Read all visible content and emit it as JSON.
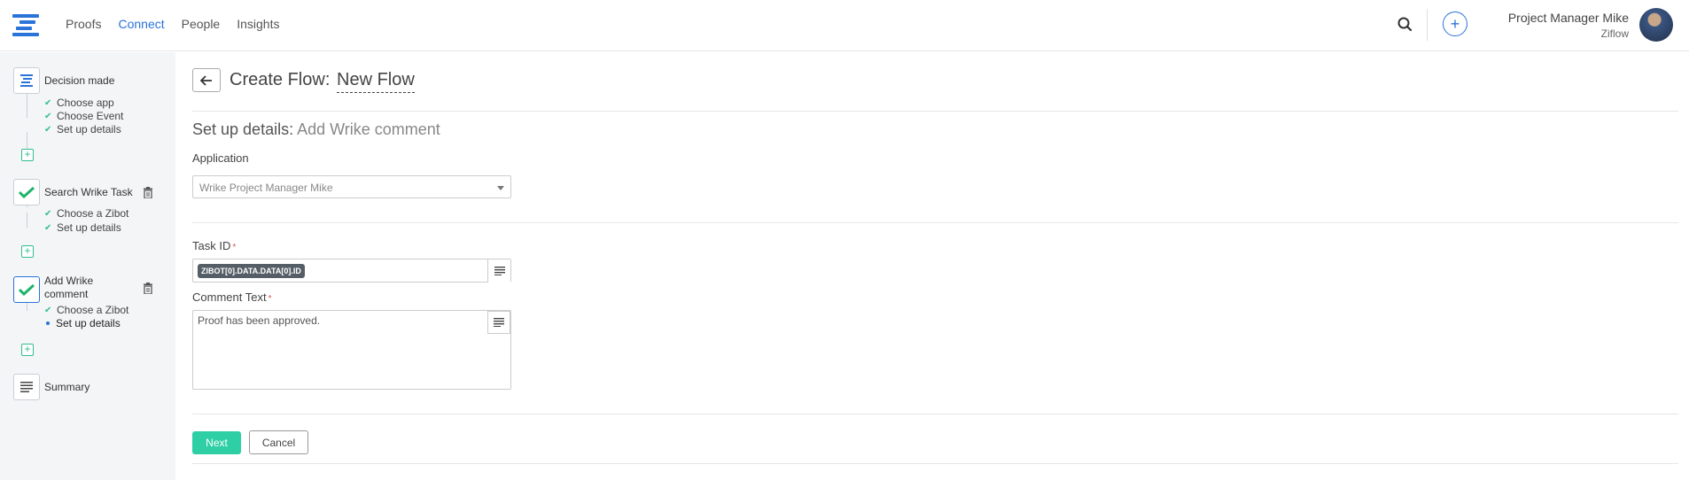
{
  "nav": {
    "items": [
      "Proofs",
      "Connect",
      "People",
      "Insights"
    ],
    "active": "Connect"
  },
  "user": {
    "name": "Project Manager Mike",
    "org": "Ziflow"
  },
  "sidebar": {
    "steps": [
      {
        "title": "Decision made",
        "subs": [
          "Choose app",
          "Choose Event",
          "Set up details"
        ]
      },
      {
        "title": "Search Wrike Task",
        "subs": [
          "Choose a Zibot",
          "Set up details"
        ]
      },
      {
        "title": "Add Wrike comment",
        "subs": [
          "Choose a Zibot",
          "Set up details"
        ]
      },
      {
        "title": "Summary",
        "subs": []
      }
    ]
  },
  "header": {
    "title_prefix": "Create Flow:",
    "flow_name": "New Flow"
  },
  "form": {
    "section_title": "Set up details:",
    "section_subtitle": "Add Wrike comment",
    "application_label": "Application",
    "application_value": "Wrike Project Manager Mike",
    "task_id_label": "Task ID",
    "task_id_token": "ZIBOT[0].DATA.DATA[0].ID",
    "comment_label": "Comment Text",
    "comment_value": "Proof has been approved.",
    "required_mark": "*"
  },
  "actions": {
    "next": "Next",
    "cancel": "Cancel"
  },
  "colors": {
    "accent": "#2a73d9",
    "success": "#2ecfa5",
    "token_bg": "#555e66"
  }
}
